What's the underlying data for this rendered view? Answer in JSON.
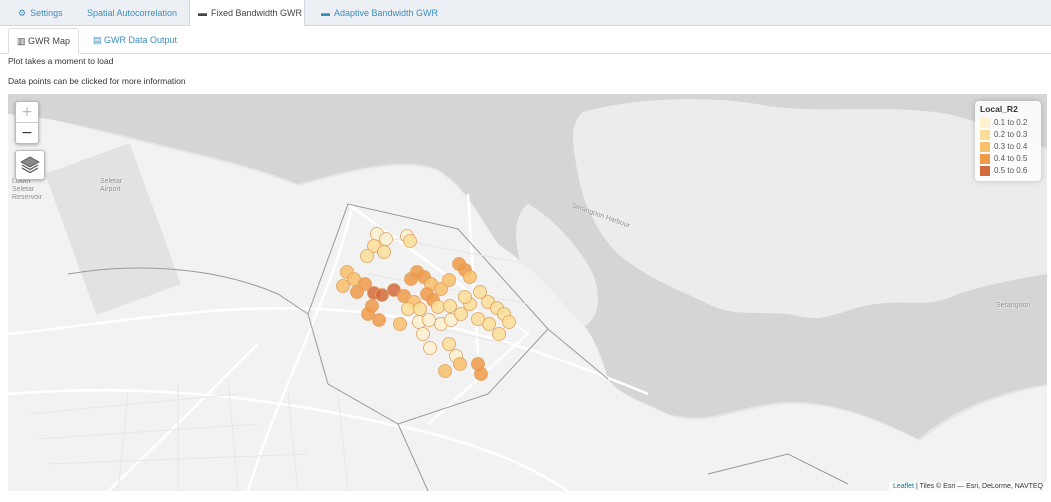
{
  "tabs": [
    {
      "label": "Settings",
      "icon": "gears-icon"
    },
    {
      "label": "Spatial Autocorrelation",
      "icon": ""
    },
    {
      "label": "Fixed Bandwidth GWR",
      "icon": "ruler-icon"
    },
    {
      "label": "Adaptive Bandwidth GWR",
      "icon": "ruler-icon"
    }
  ],
  "subtabs": [
    {
      "label": "GWR Map",
      "icon": "map-icon"
    },
    {
      "label": "GWR Data Output",
      "icon": "file-icon"
    }
  ],
  "notes": {
    "line1": "Plot takes a moment to load",
    "line2": "Data points can be clicked for more information"
  },
  "zoom": {
    "in": "+",
    "out": "−"
  },
  "legend": {
    "title": "Local_R2",
    "items": [
      {
        "label": "0.1 to 0.2",
        "color": "#fdf1cf"
      },
      {
        "label": "0.2 to 0.3",
        "color": "#fbdf99"
      },
      {
        "label": "0.3 to 0.4",
        "color": "#f8c06b"
      },
      {
        "label": "0.4 to 0.5",
        "color": "#ef9a49"
      },
      {
        "label": "0.5 to 0.6",
        "color": "#d26a3c"
      }
    ]
  },
  "map_labels": {
    "reservoir": "Lower\nSeletar\nReservoir",
    "airport": "Seletar\nAirport",
    "harbour": "Serangoon Harbour",
    "serangoon": "Serangoon"
  },
  "attribution": {
    "leaflet": "Leaflet",
    "tiles": " | Tiles © Esri — Esri, DeLorme, NAVTEQ"
  }
}
